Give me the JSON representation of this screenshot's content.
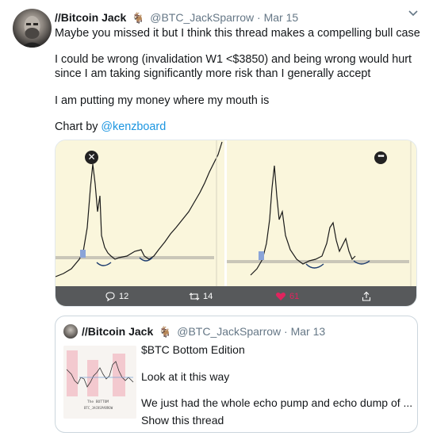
{
  "tweet": {
    "author_name": "//Bitcoin Jack",
    "author_emoji": "🐐",
    "handle": "@BTC_JackSparrow",
    "separator": "·",
    "date": "Mar 15",
    "lines": [
      "Maybe you missed it but I think this thread makes a compelling bull case",
      "I could be wrong (invalidation W1 <$3850) and being wrong would hurt",
      "since I am taking significantly more risk than I generally accept",
      "I am putting my money where my mouth is"
    ],
    "chart_by_prefix": "Chart by ",
    "chart_by_link": "@kenzboard"
  },
  "media_bar": {
    "reply_count": "12",
    "retweet_count": "14",
    "like_count": "61",
    "like_color": "#e0245e"
  },
  "quote": {
    "author_name": "//Bitcoin Jack",
    "author_emoji": "🐐",
    "handle": "@BTC_JackSparrow",
    "separator": "·",
    "date": "Mar 13",
    "title": "$BTC Bottom Edition",
    "line1": "Look at it this way",
    "line2": "We just had the whole echo pump and echo dump of ...",
    "show_thread": "Show this thread",
    "thumb_caption1": "The BOTTOM",
    "thumb_caption2": "BTC_JACKSPARROW"
  },
  "colors": {
    "link": "#1b95e0",
    "text": "#14171a",
    "muted": "#657786"
  }
}
